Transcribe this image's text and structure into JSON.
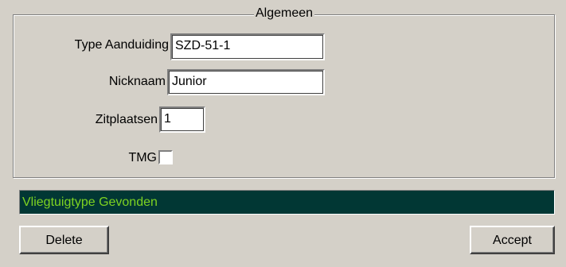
{
  "groupbox": {
    "title": "Algemeen"
  },
  "fields": {
    "type_aanduiding": {
      "label": "Type Aanduiding",
      "value": "SZD-51-1"
    },
    "nicknaam": {
      "label": "Nicknaam",
      "value": "Junior"
    },
    "zitplaatsen": {
      "label": "Zitplaatsen",
      "value": "1"
    },
    "tmg": {
      "label": "TMG",
      "checked": false
    }
  },
  "status": {
    "text": "Vliegtuigtype Gevonden",
    "colors": {
      "background": "#013734",
      "text": "#7ed321"
    }
  },
  "buttons": {
    "delete_label": "Delete",
    "accept_label": "Accept"
  }
}
